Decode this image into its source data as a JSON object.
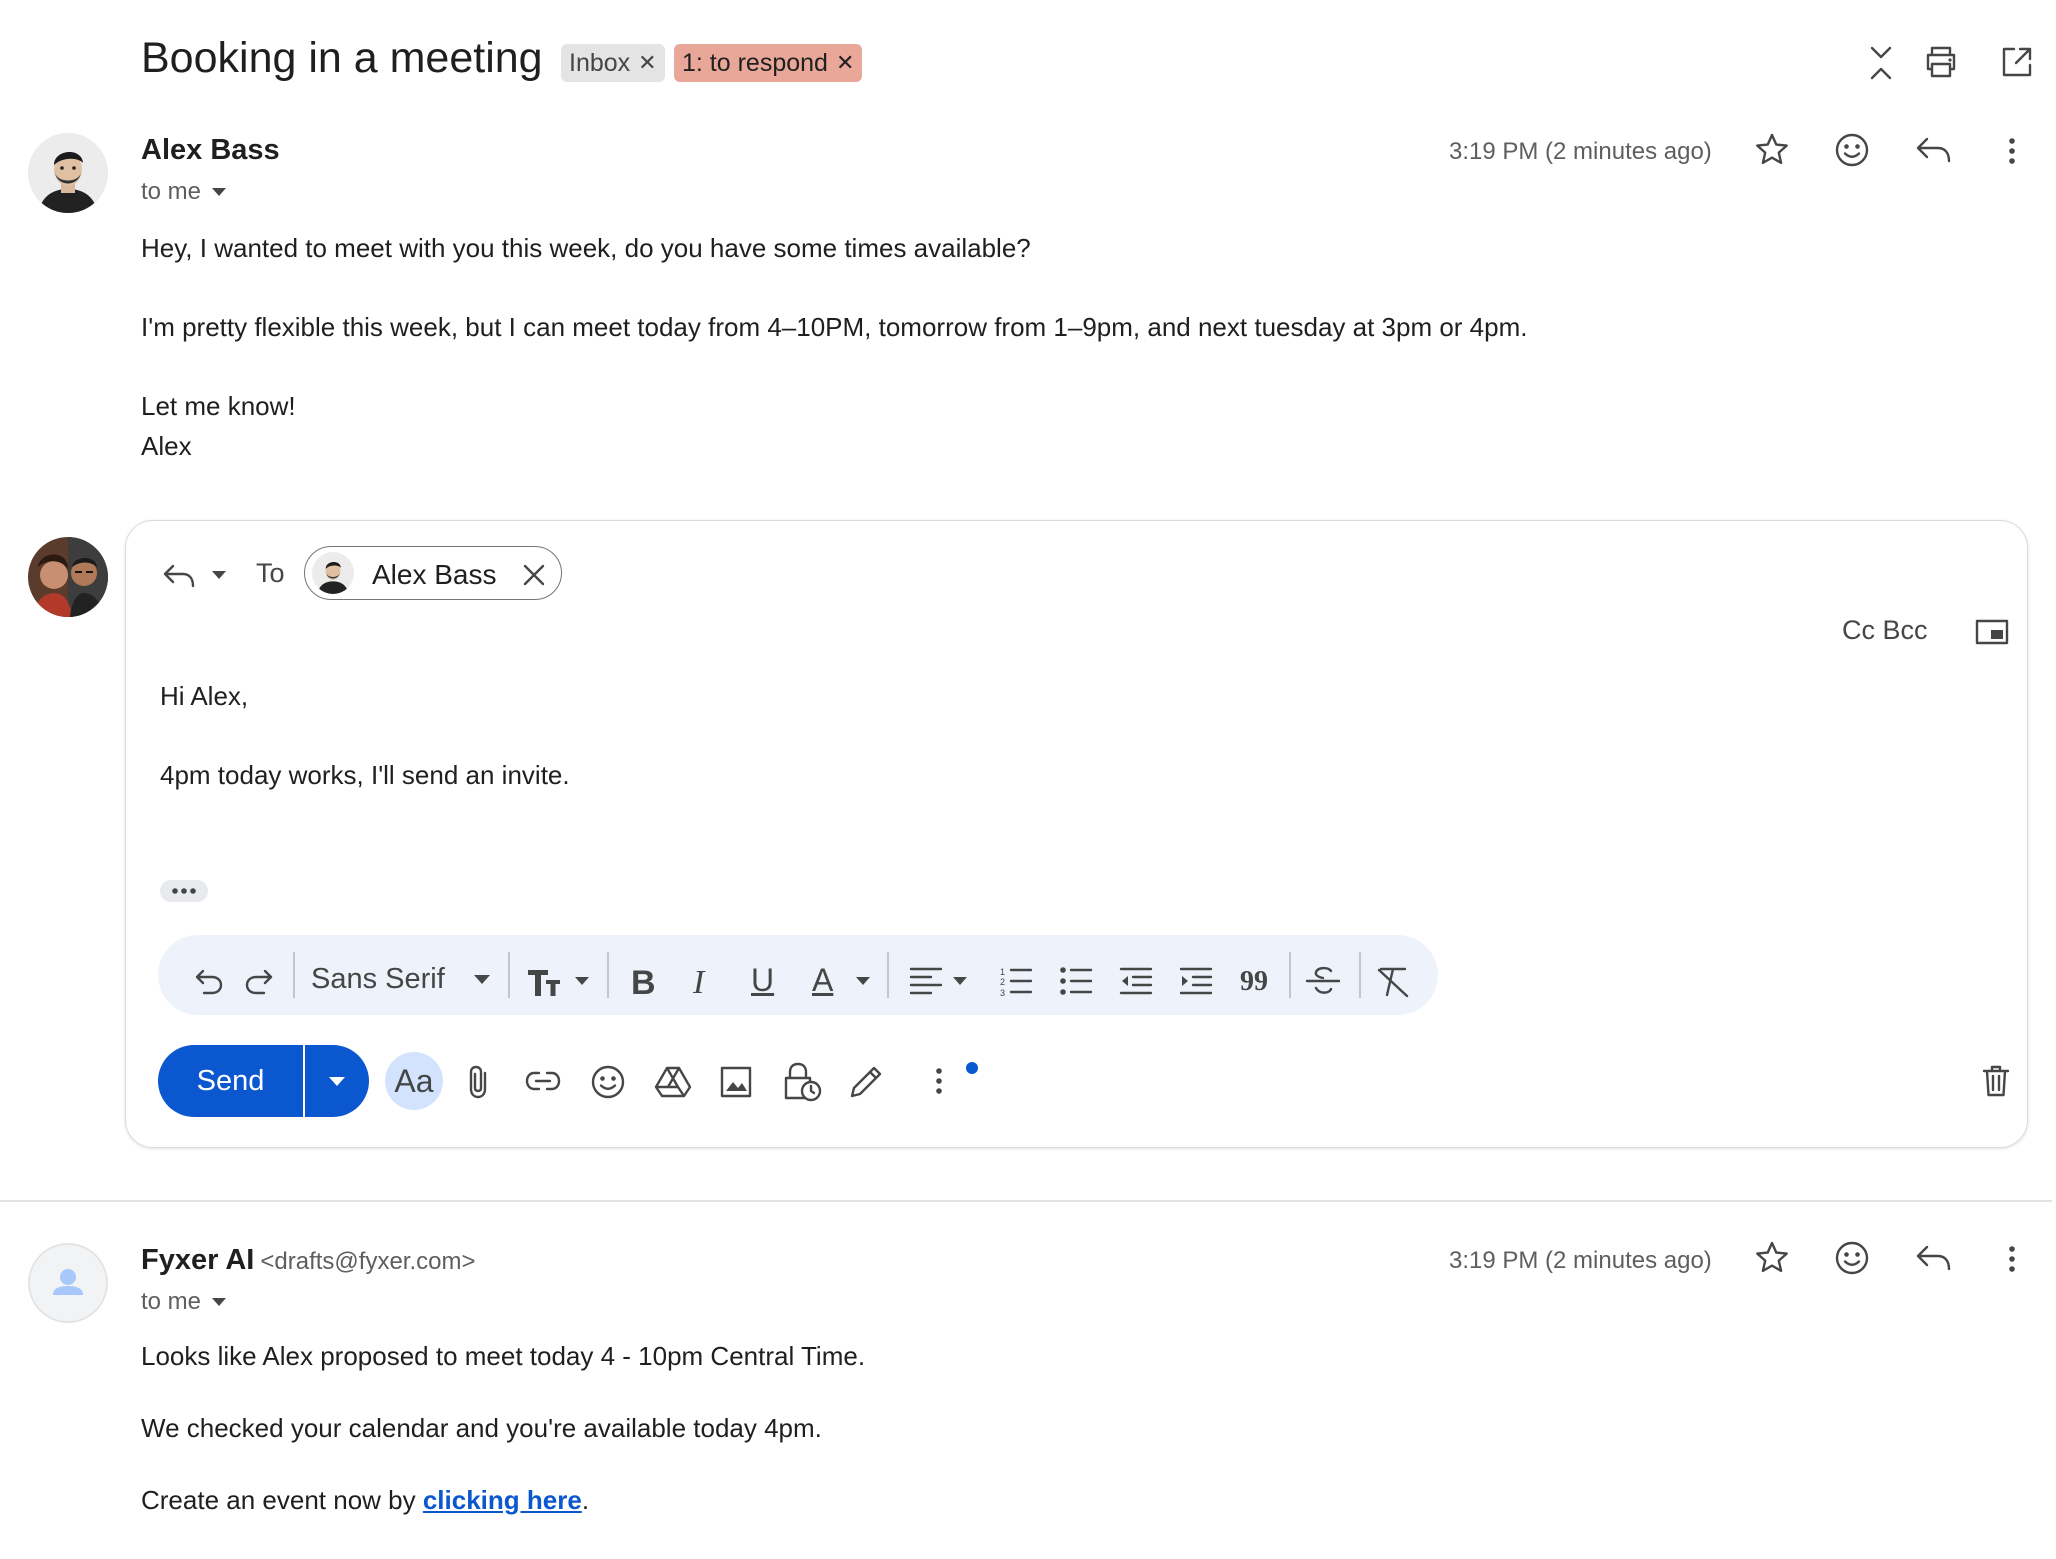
{
  "thread": {
    "subject": "Booking in a meeting",
    "labels": [
      {
        "text": "Inbox"
      },
      {
        "text": "1: to respond",
        "color": "#e8a798"
      }
    ]
  },
  "header_icons": [
    "collapse-all-icon",
    "print-icon",
    "open-in-new-window-icon"
  ],
  "message1": {
    "sender_name": "Alex Bass",
    "to_text": "to me",
    "time": "3:19 PM (2 minutes ago)",
    "body": [
      "Hey, I wanted to meet with you this week, do you have some times available?",
      "I'm pretty flexible this week, but I can meet today from 4–10PM, tomorrow from 1–9pm, and next tuesday at 3pm or 4pm.",
      "Let me know!",
      "Alex"
    ]
  },
  "reply": {
    "to_label": "To",
    "recipient": "Alex Bass",
    "cc_bcc": "Cc Bcc",
    "body": [
      "Hi Alex,",
      "4pm today works, I'll send an invite."
    ],
    "font_name": "Sans Serif",
    "send_label": "Send",
    "aa_label": "Aa",
    "quote_glyph": "99"
  },
  "message2": {
    "sender_name": "Fyxer AI",
    "sender_email": "<drafts@fyxer.com>",
    "to_text": "to me",
    "time": "3:19 PM (2 minutes ago)",
    "body": [
      "Looks like Alex proposed to meet today 4 - 10pm Central Time.",
      "We checked your calendar and you're available today 4pm."
    ],
    "cta_prefix": "Create an event now by ",
    "cta_link": "clicking here",
    "cta_suffix": "."
  },
  "colors": {
    "accent": "#0b57d0",
    "label_respond": "#e8a798",
    "label_inbox": "#e4e4e4",
    "toolbar_bg": "#eef2fb"
  }
}
